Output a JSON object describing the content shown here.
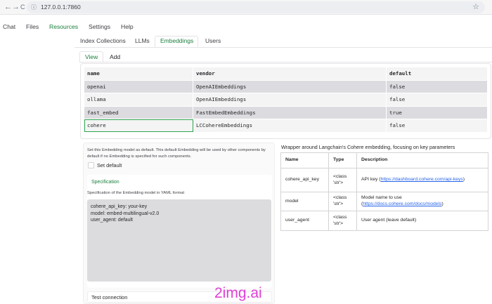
{
  "browser": {
    "back_icon": "←",
    "forward_icon": "→",
    "reload_icon": "C",
    "url": "127.0.0.1:7860",
    "star_icon": "☆"
  },
  "topnav": [
    "Chat",
    "Files",
    "Resources",
    "Settings",
    "Help"
  ],
  "subtabs": [
    "Index Collections",
    "LLMs",
    "Embeddings",
    "Users"
  ],
  "viewtabs": [
    "View",
    "Add"
  ],
  "table": {
    "headers": [
      "name",
      "vendor",
      "default"
    ],
    "rows": [
      [
        "openai",
        "OpenAIEmbeddings",
        "false"
      ],
      [
        "ollama",
        "OpenAIEmbeddings",
        "false"
      ],
      [
        "fast_embed",
        "FastEmbedEmbeddings",
        "true"
      ],
      [
        "cohere",
        "LCCohereEmbeddings",
        "false"
      ]
    ]
  },
  "settings": {
    "note": "Set this Embedding model as default. This default Embedding will be used by other components by default if no Embedding is specified for such components.",
    "default_label": "Set default",
    "spec_title": "Specification",
    "spec_desc": "Specification of the Embedding model in YAML format",
    "spec_yaml": "cohere_api_key: your-key\nmodel: embed-multilingual-v2.0\nuser_agent: default",
    "test_label": "Test connection"
  },
  "params": {
    "caption": "Wrapper around Langchain's Cohere embedding, focusing on key parameters",
    "headers": [
      "Name",
      "Type",
      "Description"
    ],
    "rows": [
      {
        "name": "cohere_api_key",
        "type": "<class 'str'>",
        "desc": "API key (",
        "link": "https://dashboard.cohere.com/api-keys",
        "desc_end": ")"
      },
      {
        "name": "model",
        "type": "<class 'str'>",
        "desc": "Model name to use (",
        "link": "https://docs.cohere.com/docs/models",
        "desc_end": ")"
      },
      {
        "name": "user_agent",
        "type": "<class 'str'>",
        "desc": "User agent (leave default)",
        "link": "",
        "desc_end": ""
      }
    ]
  },
  "watermark": "2img.ai",
  "colors": {
    "accent": "#1a7f3c",
    "link": "#2563eb",
    "watermark": "#e040d6"
  }
}
